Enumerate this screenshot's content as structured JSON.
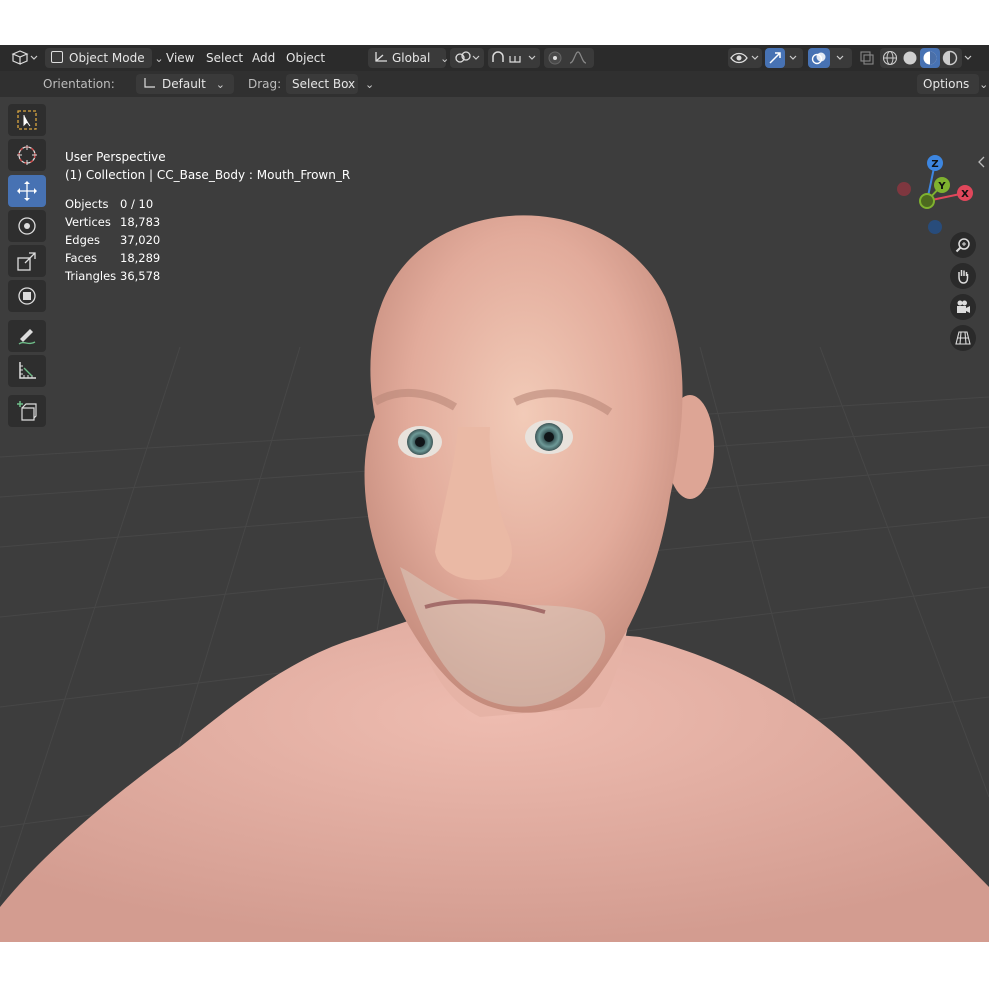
{
  "header": {
    "editor_type_icon": "3d-viewport-icon",
    "mode": "Object Mode",
    "menus": [
      "View",
      "Select",
      "Add",
      "Object"
    ],
    "transform_orientation": "Global",
    "shading_modes": [
      "wireframe",
      "solid",
      "material-preview",
      "rendered"
    ],
    "active_shading": "material-preview",
    "accent": "#4772b3"
  },
  "tool_settings": {
    "orientation_label": "Orientation:",
    "orientation_value": "Default",
    "drag_label": "Drag:",
    "drag_value": "Select Box",
    "options_label": "Options"
  },
  "toolbar": {
    "tools": [
      "select-box-icon",
      "cursor-icon",
      "move-icon",
      "rotate-icon",
      "scale-icon",
      "transform-icon",
      "annotate-icon",
      "measure-icon",
      "add-cube-icon"
    ],
    "active_tool": "move-icon"
  },
  "overlay": {
    "view_name": "User Perspective",
    "collection_line": "(1) Collection | CC_Base_Body : Mouth_Frown_R",
    "stats": [
      {
        "label": "Objects",
        "value": "0 / 10"
      },
      {
        "label": "Vertices",
        "value": "18,783"
      },
      {
        "label": "Edges",
        "value": "37,020"
      },
      {
        "label": "Faces",
        "value": "18,289"
      },
      {
        "label": "Triangles",
        "value": "36,578"
      }
    ]
  },
  "gizmo": {
    "x_label": "X",
    "y_label": "Y",
    "z_label": "Z",
    "x_color": "#e0475b",
    "y_color": "#7fb22f",
    "z_color": "#3d86e0"
  },
  "nav_buttons": [
    "zoom-icon",
    "pan-hand-icon",
    "camera-icon",
    "grid-perspective-icon"
  ]
}
